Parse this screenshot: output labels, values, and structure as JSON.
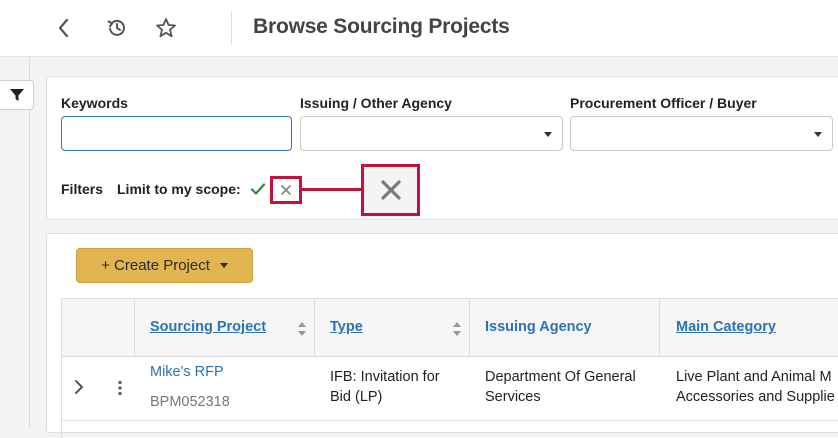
{
  "header": {
    "title": "Browse Sourcing Projects",
    "back_icon": "chevron-left-icon",
    "history_icon": "history-icon",
    "favorite_icon": "star-outline-icon"
  },
  "filters": {
    "keywords_label": "Keywords",
    "keywords_value": "",
    "agency_label": "Issuing / Other Agency",
    "agency_value": "",
    "buyer_label": "Procurement Officer / Buyer",
    "buyer_value": "",
    "filters_label": "Filters",
    "scope_label": "Limit to my scope:"
  },
  "toolbar": {
    "create_label": "+ Create Project"
  },
  "table": {
    "columns": [
      {
        "label": "Sourcing Project",
        "sortable": true
      },
      {
        "label": "Type",
        "sortable": true
      },
      {
        "label": "Issuing Agency",
        "sortable": false
      },
      {
        "label": "Main Category",
        "sortable": false
      }
    ],
    "rows": [
      {
        "project_name": "Mike's RFP",
        "project_code": "BPM052318",
        "type_line1": "IFB: Invitation for",
        "type_line2": "Bid (LP)",
        "agency_line1": "Department Of General",
        "agency_line2": "Services",
        "category_line1": "Live Plant and Animal M",
        "category_line2": "Accessories and Supplie"
      }
    ]
  },
  "colors": {
    "accent_blue": "#2b73b6",
    "highlight_red": "#c0143c",
    "create_button": "#e2b551",
    "check_green": "#2e8b3a"
  }
}
